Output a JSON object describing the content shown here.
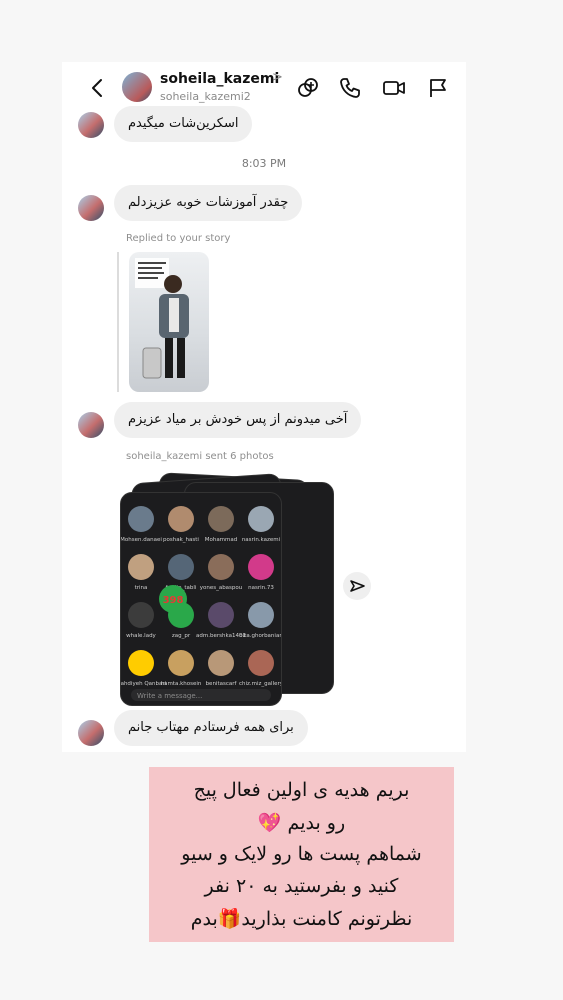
{
  "header": {
    "display_name": "soheila_kazemi",
    "chevron": ">",
    "username": "soheila_kazemi2"
  },
  "messages": {
    "m1": "اسکرین‌شات میگیدم",
    "time": "8:03 PM",
    "m2": "چقدر آموزشات خوبه عزیزدلم",
    "replied_label": "Replied to your story",
    "m3": "آخی میدونم از پس خودش بر میاد عزیزم",
    "sent_photos_label": "soheila_kazemi sent 6 photos",
    "m4": "برای همه فرستادم  مهتاب جانم"
  },
  "story_text": "Replied to your story",
  "photo_grid": {
    "names": [
      "Mohsen.danaei",
      "poshak_hasti",
      "Mohammad",
      "nasrin.kazemi",
      "trina",
      "fardin_tabli",
      "yones_abaspou",
      "nasrin.73",
      "whale.lady",
      "zag_pr",
      "adm.bershka1401",
      "bita.ghorbanian",
      "Mahdiyeh Qanbari",
      "hamta.khosein",
      "benitascarf",
      "chiz.miz_gallery"
    ],
    "badge_text": "398",
    "write_placeholder": "Write a message..."
  },
  "overlay": {
    "line1": "بریم هدیه ی اولین فعال پیج",
    "line2": "رو بدیم 💖",
    "line3": "شماهم پست ها رو لایک و سیو",
    "line4": "کنید و بفرستید به ۲۰ نفر",
    "line5": "نظرتونم کامنت بذارید🎁بدم"
  },
  "colors": {
    "bubble": "#efefef",
    "overlay_bg": "#f5c6c9",
    "photo_card_bg": "#1c1c1e"
  }
}
